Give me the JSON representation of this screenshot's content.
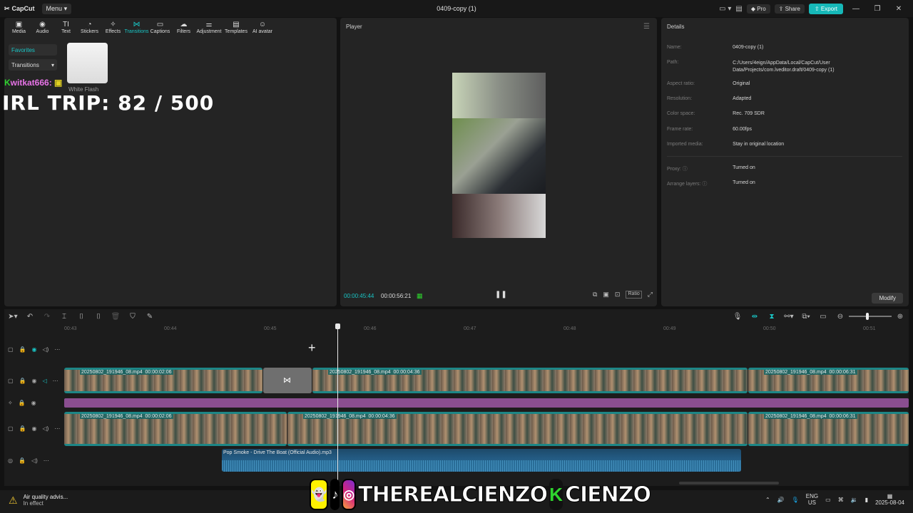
{
  "app": {
    "logo": "CapCut",
    "menu": "Menu",
    "window_title": "0409-copy (1)",
    "pro": "Pro",
    "share": "Share",
    "export": "Export"
  },
  "media_toolbar": [
    {
      "label": "Media",
      "icon": "media-icon"
    },
    {
      "label": "Audio",
      "icon": "audio-icon"
    },
    {
      "label": "Text",
      "icon": "text-icon"
    },
    {
      "label": "Stickers",
      "icon": "stickers-icon"
    },
    {
      "label": "Effects",
      "icon": "effects-icon"
    },
    {
      "label": "Transitions",
      "icon": "transitions-icon"
    },
    {
      "label": "Captions",
      "icon": "captions-icon"
    },
    {
      "label": "Filters",
      "icon": "filters-icon"
    },
    {
      "label": "Adjustment",
      "icon": "adjustment-icon"
    },
    {
      "label": "Templates",
      "icon": "templates-icon"
    },
    {
      "label": "AI avatar",
      "icon": "ai-avatar-icon"
    }
  ],
  "left_panel": {
    "favorites": "Favorites",
    "transitions_dropdown": "Transitions",
    "thumb_label": "White Flash",
    "overlay_user": "witkat666:",
    "overlay_trip": "IRL TRIP:  82 / 500"
  },
  "player": {
    "title": "Player",
    "current_time": "00:00:45:44",
    "total_time": "00:00:56:21",
    "ratio": "Ratio"
  },
  "details": {
    "title": "Details",
    "rows": [
      {
        "key": "Name:",
        "value": "0409-copy (1)"
      },
      {
        "key": "Path:",
        "value": "C:/Users/4eign/AppData/Local/CapCut/User Data/Projects/com.lveditor.draft/0409-copy (1)"
      },
      {
        "key": "Aspect ratio:",
        "value": "Original"
      },
      {
        "key": "Resolution:",
        "value": "Adapted"
      },
      {
        "key": "Color space:",
        "value": "Rec. 709 SDR"
      },
      {
        "key": "Frame rate:",
        "value": "60.00fps"
      },
      {
        "key": "Imported media:",
        "value": "Stay in original location"
      },
      {
        "key": "Proxy:",
        "value": "Turned on"
      },
      {
        "key": "Arrange layers:",
        "value": "Turned on"
      }
    ],
    "modify": "Modify"
  },
  "timeline": {
    "ruler": [
      "00:43",
      "00:44",
      "00:45",
      "00:46",
      "00:47",
      "00:48",
      "00:49",
      "00:50",
      "00:51"
    ],
    "clips_main": [
      {
        "name": "20250802_191946_08.mp4",
        "duration": "00:00:02:06"
      },
      {
        "name": "20250802_191946_08.mp4",
        "duration": "00:00:04:36"
      },
      {
        "name": "20250802_191946_08.mp4",
        "duration": "00:00:06:31"
      }
    ],
    "clips_lower": [
      {
        "name": "20250802_191946_08.mp4",
        "duration": "00:00:02:06"
      },
      {
        "name": "20250802_191946_08.mp4",
        "duration": "00:00:04:36"
      },
      {
        "name": "20250802_191946_08.mp4",
        "duration": "00:00:06:31"
      }
    ],
    "audio_clip": "Pop Smoke - Drive The Boat (Official Audio).mp3"
  },
  "taskbar": {
    "notif_title": "Air quality advis...",
    "notif_sub": "In effect",
    "social_handle_1": "THEREALCIENZO",
    "social_handle_2": "CIENZO",
    "lang_1": "ENG",
    "lang_2": "US",
    "date": "2025-08-04"
  }
}
